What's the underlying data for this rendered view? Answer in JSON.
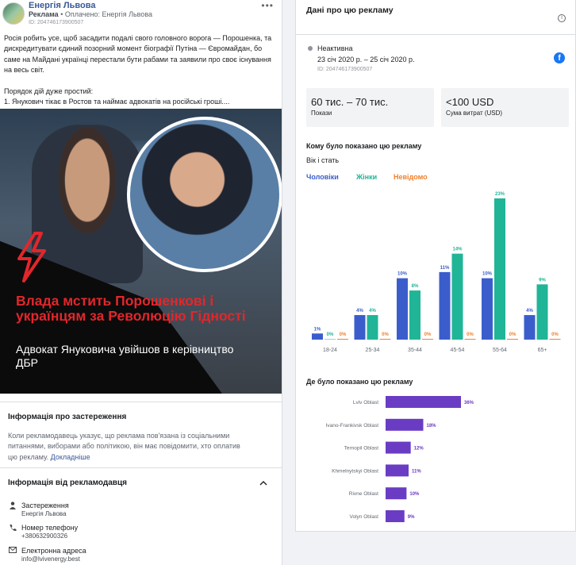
{
  "ad": {
    "page_name": "Енергія Львова",
    "sponsored_label": "Реклама",
    "paid_by_prefix": "• Оплачено: Енергія Львова",
    "id_label": "ID: 204746173900507",
    "menu_dots": "•••",
    "paragraph1": "Росія робить усе, щоб засадити подалі свого головного ворога — Порошенка, та дискредитувати єдиний позорний момент біографії Путіна — Євромайдан, бо саме на Майдані українці перестали бути рабами та заявили про своє існування на весь світ.",
    "paragraph2_line1": "Порядок дій дуже простий:",
    "paragraph2_line2": "1. Янукович тікає в Ростов та наймає адвокатів на російські гроші....",
    "creative": {
      "headline": "Влада мстить Порошенкові і українцям за Революцію Гідності",
      "subline": "Адвокат Януковича увійшов в керівництво ДБР",
      "accent_color": "#e3262b"
    }
  },
  "disclaimer_section": {
    "title": "Інформація про застереження",
    "text": "Коли рекламодавець указує, що реклама пов'язана із соціальними питаннями, виборами або політикою, він має повідомити, хто оплатив цю рекламу.",
    "link": "Докладніше"
  },
  "advertiser_section": {
    "title": "Інформація від рекламодавця",
    "chevron_icon": "chevron-up-icon",
    "rows": [
      {
        "icon": "disclaimer-icon",
        "label": "Застереження",
        "value": "Енергія Львова"
      },
      {
        "icon": "phone-icon",
        "label": "Номер телефону",
        "value": "+380632900326"
      },
      {
        "icon": "email-icon",
        "label": "Електронна адреса",
        "value": "info@lvivenergy.best"
      }
    ]
  },
  "panel": {
    "title": "Дані про цю рекламу",
    "info_icon": "info-icon",
    "status": "Неактивна",
    "dates": "23 січ 2020 р. – 25 січ 2020 р.",
    "id_label": "ID: 204746173900507",
    "platform_icon": "facebook-icon",
    "impressions_value": "60 тис. – 70 тис.",
    "impressions_label": "Покази",
    "spend_value": "<100 USD",
    "spend_label": "Сума витрат (USD)",
    "audience_heading": "Кому було показано цю рекламу",
    "age_gender_heading": "Вік і стать",
    "legend": {
      "men": "Чоловіки",
      "women": "Жінки",
      "unknown": "Невідомо"
    },
    "colors": {
      "men": "#3b5dcc",
      "women": "#20b597",
      "unknown": "#f1812f",
      "region": "#6a3cc4"
    },
    "regions_heading": "Де було показано цю рекламу"
  },
  "chart_data": [
    {
      "type": "bar",
      "title": "Вік і стать",
      "categories": [
        "18-24",
        "25-34",
        "35-44",
        "45-54",
        "55-64",
        "65+"
      ],
      "series": [
        {
          "name": "Чоловіки",
          "values": [
            1,
            4,
            10,
            11,
            10,
            4
          ],
          "labels": [
            "1%",
            "4%",
            "10%",
            "11%",
            "10%",
            "4%"
          ]
        },
        {
          "name": "Жінки",
          "values": [
            0,
            4,
            8,
            14,
            23,
            9
          ],
          "labels": [
            "0%",
            "4%",
            "8%",
            "14%",
            "23%",
            "9%"
          ]
        },
        {
          "name": "Невідомо",
          "values": [
            0,
            0,
            0,
            0,
            0,
            0
          ],
          "labels": [
            "0%",
            "0%",
            "0%",
            "0%",
            "0%",
            "0%"
          ]
        }
      ],
      "ylim": [
        0,
        23
      ],
      "grid": false,
      "legend": "top-left"
    },
    {
      "type": "bar",
      "orientation": "horizontal",
      "title": "Де було показано цю рекламу",
      "categories": [
        "Lviv Oblast",
        "Ivano-Frankivsk Oblast",
        "Ternopil Oblast",
        "Khmelnytskyi Oblast",
        "Rivne Oblast",
        "Volyn Oblast"
      ],
      "values": [
        36,
        18,
        12,
        11,
        10,
        9
      ],
      "labels": [
        "36%",
        "18%",
        "12%",
        "11%",
        "10%",
        "9%"
      ],
      "xlim": [
        0,
        36
      ]
    }
  ]
}
